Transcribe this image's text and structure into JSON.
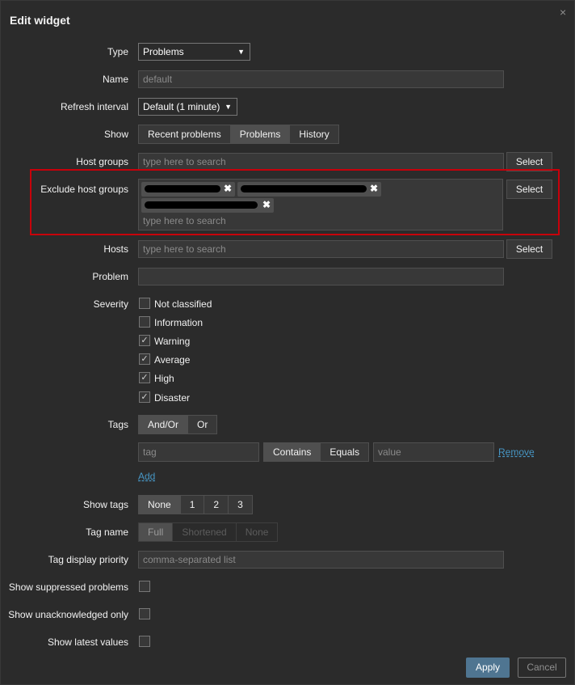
{
  "dialog": {
    "title": "Edit widget",
    "close_glyph": "×"
  },
  "form": {
    "type": {
      "label": "Type",
      "value": "Problems"
    },
    "name": {
      "label": "Name",
      "placeholder": "default"
    },
    "refresh": {
      "label": "Refresh interval",
      "value": "Default (1 minute)"
    },
    "show": {
      "label": "Show",
      "options": [
        "Recent problems",
        "Problems",
        "History"
      ],
      "selected": "Problems"
    },
    "host_groups": {
      "label": "Host groups",
      "placeholder": "type here to search",
      "select_label": "Select"
    },
    "exclude_host_groups": {
      "label": "Exclude host groups",
      "placeholder": "type here to search",
      "select_label": "Select",
      "remove_glyph": "✖"
    },
    "hosts": {
      "label": "Hosts",
      "placeholder": "type here to search",
      "select_label": "Select"
    },
    "problem": {
      "label": "Problem",
      "value": ""
    },
    "severity": {
      "label": "Severity",
      "items": [
        {
          "label": "Not classified",
          "checked": false
        },
        {
          "label": "Information",
          "checked": false
        },
        {
          "label": "Warning",
          "checked": true
        },
        {
          "label": "Average",
          "checked": true
        },
        {
          "label": "High",
          "checked": true
        },
        {
          "label": "Disaster",
          "checked": true
        }
      ]
    },
    "tags": {
      "label": "Tags",
      "eval_options": [
        "And/Or",
        "Or"
      ],
      "eval_selected": "And/Or",
      "tag_placeholder": "tag",
      "operator_options": [
        "Contains",
        "Equals"
      ],
      "operator_selected": "Contains",
      "value_placeholder": "value",
      "remove_label": "Remove",
      "add_label": "Add"
    },
    "show_tags": {
      "label": "Show tags",
      "options": [
        "None",
        "1",
        "2",
        "3"
      ],
      "selected": "None"
    },
    "tag_name": {
      "label": "Tag name",
      "options": [
        "Full",
        "Shortened",
        "None"
      ],
      "selected": "Full"
    },
    "tag_priority": {
      "label": "Tag display priority",
      "placeholder": "comma-separated list"
    },
    "show_suppressed": {
      "label": "Show suppressed problems",
      "checked": false
    },
    "show_unack": {
      "label": "Show unacknowledged only",
      "checked": false
    },
    "show_latest": {
      "label": "Show latest values",
      "checked": false
    }
  },
  "footer": {
    "apply_label": "Apply",
    "cancel_label": "Cancel"
  },
  "check_glyph": "✓",
  "icons": {
    "close": "close-icon",
    "dropdown": "chevron-down-icon",
    "remove": "remove-icon",
    "check": "check-icon"
  }
}
